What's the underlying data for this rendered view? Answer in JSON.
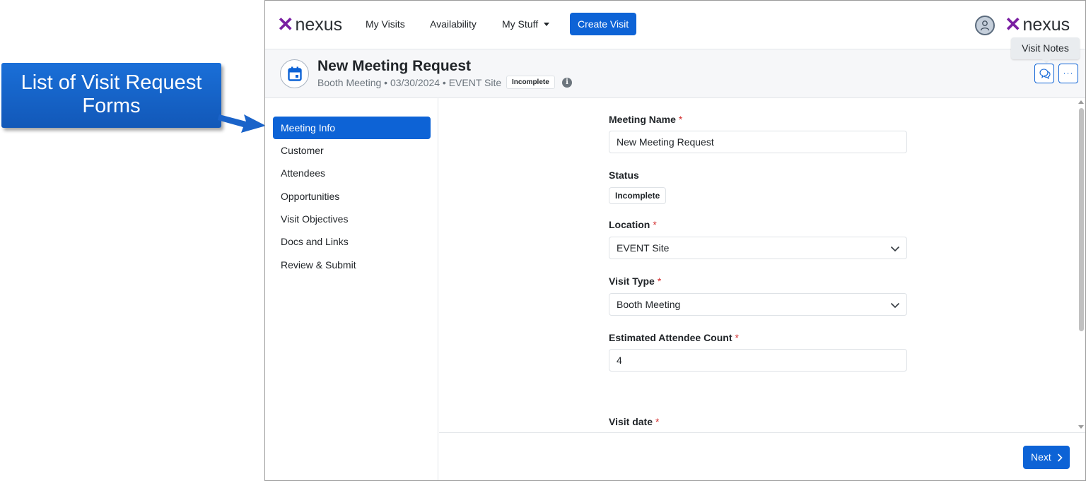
{
  "annotation": {
    "callout_text": "List of Visit Request Forms"
  },
  "navbar": {
    "brand_left": "nexus",
    "brand_right": "nexus",
    "links": [
      "My Visits",
      "Availability",
      "My Stuff"
    ],
    "create_button": "Create Visit",
    "tooltip": "Visit Notes"
  },
  "header": {
    "title": "New Meeting Request",
    "subtitle": "Booth Meeting • 03/30/2024 • EVENT Site",
    "badge": "Incomplete",
    "info_icon": "i"
  },
  "sidebar": {
    "items": [
      {
        "label": "Meeting Info",
        "active": true
      },
      {
        "label": "Customer"
      },
      {
        "label": "Attendees"
      },
      {
        "label": "Opportunities"
      },
      {
        "label": "Visit Objectives"
      },
      {
        "label": "Docs and Links"
      },
      {
        "label": "Review & Submit"
      }
    ]
  },
  "form": {
    "meeting_name": {
      "label": "Meeting Name",
      "required": "*",
      "value": "New Meeting Request"
    },
    "status": {
      "label": "Status",
      "value": "Incomplete"
    },
    "location": {
      "label": "Location",
      "required": "*",
      "value": "EVENT Site"
    },
    "visit_type": {
      "label": "Visit Type",
      "required": "*",
      "value": "Booth Meeting"
    },
    "attendee_count": {
      "label": "Estimated Attendee Count",
      "required": "*",
      "value": "4"
    },
    "visit_date": {
      "label": "Visit date",
      "required": "*"
    }
  },
  "footer": {
    "next_label": "Next"
  },
  "colors": {
    "primary": "#0d63d6",
    "required": "#d32f2f",
    "brand_purple": "#7a1fa2",
    "brand_pink": "#c2185b"
  }
}
